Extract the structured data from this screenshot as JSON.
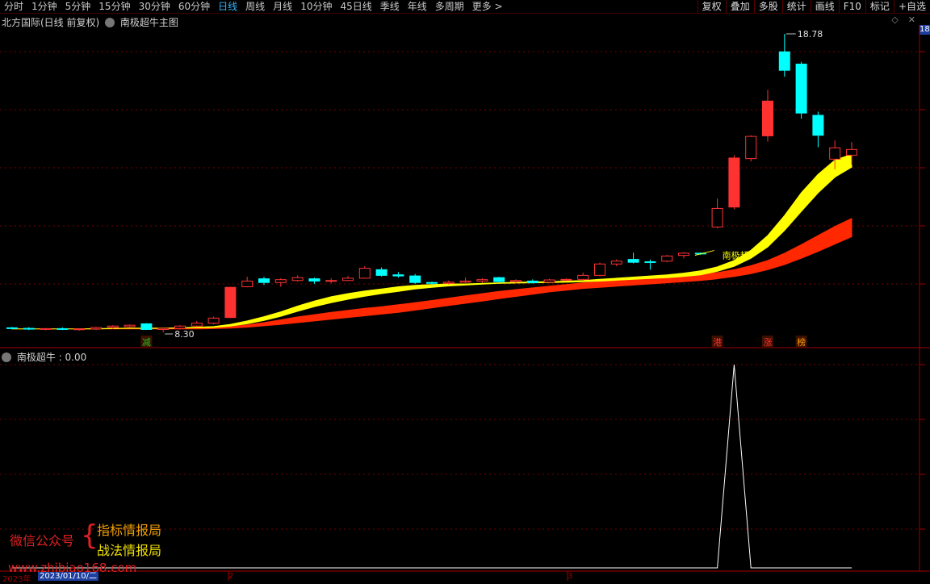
{
  "toolbar": {
    "periods": [
      {
        "label": "分时",
        "active": false
      },
      {
        "label": "1分钟",
        "active": false
      },
      {
        "label": "5分钟",
        "active": false
      },
      {
        "label": "15分钟",
        "active": false
      },
      {
        "label": "30分钟",
        "active": false
      },
      {
        "label": "60分钟",
        "active": false
      },
      {
        "label": "日线",
        "active": true
      },
      {
        "label": "周线",
        "active": false
      },
      {
        "label": "月线",
        "active": false
      },
      {
        "label": "10分钟",
        "active": false
      },
      {
        "label": "45日线",
        "active": false
      },
      {
        "label": "季线",
        "active": false
      },
      {
        "label": "年线",
        "active": false
      },
      {
        "label": "多周期",
        "active": false
      },
      {
        "label": "更多 >",
        "active": false
      }
    ],
    "tools": [
      "复权",
      "叠加",
      "多股",
      "统计",
      "画线",
      "F10",
      "标记",
      "+自选"
    ]
  },
  "main_chart": {
    "stock_title": "北方国际(日线 前复权)",
    "indicator_name": "南极超牛主图",
    "price_tag": "18",
    "high_label": "18.78",
    "low_label": "8.30",
    "signal_label": "南极超",
    "marker_labels": [
      {
        "text": "减",
        "color": "#20c020"
      },
      {
        "text": "港",
        "color": "#ff3030"
      },
      {
        "text": "涨",
        "color": "#ff3030"
      },
      {
        "text": "榜",
        "color": "#ffa000"
      }
    ]
  },
  "sub_chart": {
    "title": "南极超牛 : 0.00"
  },
  "watermark": {
    "left": "微信公众号",
    "brace": "{",
    "right1": "指标情报局",
    "right2": "战法情报局",
    "url": "www.zhibiao168.com"
  },
  "date_axis": {
    "year": "2023年",
    "cursor_date": "2023/01/10/二",
    "month2": "2",
    "month3": "3"
  },
  "chart_data": [
    {
      "type": "candlestick",
      "candles": [
        [
          8.46,
          8.49,
          8.4,
          8.44
        ],
        [
          8.44,
          8.48,
          8.38,
          8.42
        ],
        [
          8.42,
          8.45,
          8.37,
          8.43
        ],
        [
          8.43,
          8.47,
          8.38,
          8.41
        ],
        [
          8.41,
          8.44,
          8.36,
          8.42
        ],
        [
          8.42,
          8.5,
          8.38,
          8.47
        ],
        [
          8.47,
          8.55,
          8.42,
          8.52
        ],
        [
          8.5,
          8.58,
          8.46,
          8.55
        ],
        [
          8.6,
          8.62,
          8.38,
          8.4
        ],
        [
          8.4,
          8.46,
          8.3,
          8.44
        ],
        [
          8.44,
          8.55,
          8.4,
          8.52
        ],
        [
          8.52,
          8.7,
          8.5,
          8.62
        ],
        [
          8.62,
          8.85,
          8.58,
          8.8
        ],
        [
          8.82,
          9.9,
          8.8,
          9.88
        ],
        [
          9.9,
          10.25,
          9.88,
          10.1
        ],
        [
          10.18,
          10.25,
          9.96,
          10.05
        ],
        [
          10.05,
          10.2,
          9.9,
          10.15
        ],
        [
          10.12,
          10.3,
          10.08,
          10.22
        ],
        [
          10.18,
          10.22,
          10.0,
          10.1
        ],
        [
          10.1,
          10.2,
          10.02,
          10.12
        ],
        [
          10.12,
          10.28,
          10.1,
          10.2
        ],
        [
          10.2,
          10.62,
          10.18,
          10.55
        ],
        [
          10.5,
          10.58,
          10.26,
          10.3
        ],
        [
          10.32,
          10.42,
          10.22,
          10.28
        ],
        [
          10.28,
          10.35,
          10.0,
          10.05
        ],
        [
          10.05,
          10.08,
          9.95,
          10.02
        ],
        [
          10.02,
          10.12,
          9.98,
          10.06
        ],
        [
          10.06,
          10.22,
          10.0,
          10.1
        ],
        [
          10.1,
          10.2,
          10.04,
          10.15
        ],
        [
          10.22,
          10.25,
          10.05,
          10.08
        ],
        [
          10.08,
          10.16,
          10.02,
          10.12
        ],
        [
          10.1,
          10.16,
          10.02,
          10.04
        ],
        [
          10.06,
          10.18,
          10.02,
          10.14
        ],
        [
          10.14,
          10.2,
          10.1,
          10.16
        ],
        [
          10.16,
          10.4,
          10.12,
          10.3
        ],
        [
          10.3,
          10.75,
          10.28,
          10.7
        ],
        [
          10.7,
          10.86,
          10.62,
          10.8
        ],
        [
          10.86,
          11.1,
          10.72,
          10.76
        ],
        [
          10.78,
          10.86,
          10.5,
          10.76
        ],
        [
          10.8,
          11.02,
          10.76,
          10.98
        ],
        [
          11.0,
          11.12,
          10.9,
          11.08
        ],
        [
          11.08,
          11.1,
          11.02,
          11.06
        ],
        [
          12.0,
          13.0,
          11.95,
          12.65
        ],
        [
          12.7,
          14.52,
          12.62,
          14.42
        ],
        [
          14.4,
          15.22,
          14.3,
          15.18
        ],
        [
          15.2,
          16.82,
          15.0,
          16.42
        ],
        [
          18.15,
          18.78,
          17.28,
          17.5
        ],
        [
          17.72,
          17.8,
          15.8,
          16.0
        ],
        [
          15.92,
          16.05,
          14.8,
          15.22
        ],
        [
          14.38,
          15.04,
          14.02,
          14.78
        ],
        [
          14.52,
          14.98,
          14.18,
          14.72
        ]
      ],
      "rising_color": "#ff3232",
      "falling_color": "#00ffff",
      "price_min": 8.3,
      "price_max": 18.78
    },
    {
      "type": "area",
      "series": [
        {
          "values": [
            8.42,
            8.42,
            8.42,
            8.42,
            8.42,
            8.43,
            8.44,
            8.45,
            8.45,
            8.45,
            8.46,
            8.48,
            8.5,
            8.58,
            8.7,
            8.85,
            9.02,
            9.22,
            9.4,
            9.55,
            9.66,
            9.75,
            9.82,
            9.9,
            9.95,
            9.98,
            10.0,
            10.0,
            10.02,
            10.04,
            10.06,
            10.07,
            10.08,
            10.1,
            10.12,
            10.16,
            10.2,
            10.24,
            10.28,
            10.32,
            10.38,
            10.46,
            10.6,
            10.82,
            11.18,
            11.7,
            12.4,
            13.2,
            13.85,
            14.35,
            14.55
          ],
          "color": "#ffff00"
        },
        {
          "values": [
            8.42,
            8.42,
            8.42,
            8.42,
            8.42,
            8.42,
            8.43,
            8.44,
            8.44,
            8.44,
            8.45,
            8.46,
            8.47,
            8.52,
            8.6,
            8.72,
            8.86,
            9.04,
            9.2,
            9.34,
            9.46,
            9.57,
            9.66,
            9.74,
            9.82,
            9.88,
            9.93,
            9.96,
            9.99,
            10.02,
            10.03,
            10.04,
            10.05,
            10.06,
            10.08,
            10.1,
            10.13,
            10.16,
            10.19,
            10.22,
            10.26,
            10.32,
            10.44,
            10.62,
            10.9,
            11.3,
            11.88,
            12.55,
            13.2,
            13.75,
            14.1
          ],
          "color": "#ffff00"
        },
        {
          "values": [
            8.42,
            8.42,
            8.42,
            8.42,
            8.42,
            8.42,
            8.42,
            8.43,
            8.43,
            8.43,
            8.43,
            8.44,
            8.45,
            8.5,
            8.56,
            8.64,
            8.74,
            8.84,
            8.92,
            9.0,
            9.07,
            9.14,
            9.2,
            9.27,
            9.34,
            9.42,
            9.5,
            9.58,
            9.66,
            9.74,
            9.8,
            9.86,
            9.92,
            9.98,
            10.04,
            10.08,
            10.12,
            10.16,
            10.2,
            10.24,
            10.28,
            10.33,
            10.4,
            10.5,
            10.64,
            10.82,
            11.08,
            11.38,
            11.7,
            12.02,
            12.3
          ],
          "color": "#ff2800"
        },
        {
          "values": [
            8.42,
            8.42,
            8.42,
            8.42,
            8.42,
            8.42,
            8.42,
            8.42,
            8.42,
            8.42,
            8.42,
            8.42,
            8.43,
            8.45,
            8.48,
            8.53,
            8.58,
            8.64,
            8.7,
            8.76,
            8.82,
            8.88,
            8.94,
            9.0,
            9.08,
            9.16,
            9.24,
            9.32,
            9.4,
            9.48,
            9.56,
            9.64,
            9.72,
            9.78,
            9.84,
            9.88,
            9.92,
            9.96,
            10.0,
            10.04,
            10.08,
            10.12,
            10.18,
            10.26,
            10.36,
            10.5,
            10.68,
            10.9,
            11.14,
            11.4,
            11.66
          ],
          "color": "#ff2800"
        }
      ]
    },
    {
      "type": "line",
      "y_min": 0,
      "y_max": 100,
      "peak_value": 100,
      "peak_index": 43,
      "current_value": 0.0,
      "color": "#ffffff"
    }
  ]
}
